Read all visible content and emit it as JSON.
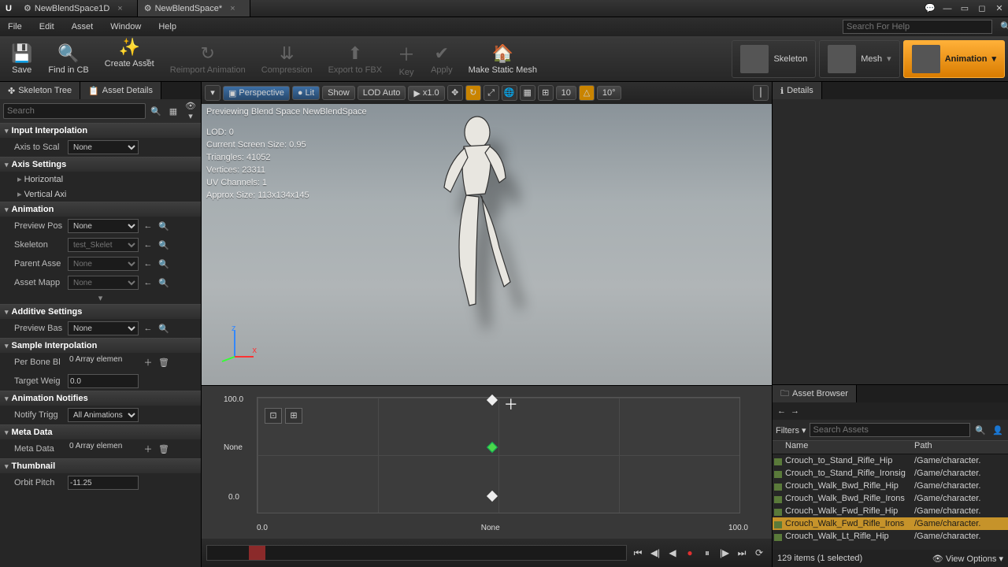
{
  "tabs": {
    "t1": "NewBlendSpace1D",
    "t2": "NewBlendSpace*"
  },
  "menu": {
    "file": "File",
    "edit": "Edit",
    "asset": "Asset",
    "window": "Window",
    "help": "Help"
  },
  "search_help_ph": "Search For Help",
  "toolbar": {
    "save": "Save",
    "find": "Find in CB",
    "create": "Create Asset",
    "reimport": "Reimport Animation",
    "compression": "Compression",
    "export": "Export to FBX",
    "key": "Key",
    "apply": "Apply",
    "static": "Make Static Mesh"
  },
  "modes": {
    "skeleton": "Skeleton",
    "mesh": "Mesh",
    "animation": "Animation"
  },
  "left_tabs": {
    "skel": "Skeleton Tree",
    "asset": "Asset Details"
  },
  "left_search_ph": "Search",
  "sections": {
    "input": "Input Interpolation",
    "axis": "Axis Settings",
    "anim": "Animation",
    "additive": "Additive Settings",
    "sample": "Sample Interpolation",
    "notifies": "Animation Notifies",
    "meta": "Meta Data",
    "thumb": "Thumbnail"
  },
  "props": {
    "axis_scale_lbl": "Axis to Scal",
    "axis_scale_val": "None",
    "horiz": "Horizontal",
    "vert": "Vertical Axi",
    "preview_pos_lbl": "Preview Pos",
    "preview_pos_val": "None",
    "skeleton_lbl": "Skeleton",
    "skeleton_val": "test_Skelet",
    "parent_lbl": "Parent Asse",
    "parent_val": "None",
    "mapping_lbl": "Asset Mapp",
    "mapping_val": "None",
    "preview_base_lbl": "Preview Bas",
    "preview_base_val": "None",
    "per_bone_lbl": "Per Bone Bl",
    "per_bone_val": "0 Array elemen",
    "target_lbl": "Target Weig",
    "target_val": "0.0",
    "notify_lbl": "Notify Trigg",
    "notify_val": "All Animations",
    "meta_lbl": "Meta Data",
    "meta_val": "0 Array elemen",
    "orbit_lbl": "Orbit Pitch",
    "orbit_val": "-11.25"
  },
  "vp_toolbar": {
    "persp": "Perspective",
    "lit": "Lit",
    "show": "Show",
    "lod": "LOD Auto",
    "speed": "x1.0",
    "grid1": "10",
    "grid2": "10°"
  },
  "vp_overlay": {
    "preview": "Previewing Blend Space NewBlendSpace",
    "lod": "LOD: 0",
    "screen": "Current Screen Size: 0.95",
    "tris": "Triangles: 41052",
    "verts": "Vertices: 23311",
    "uv": "UV Channels: 1",
    "approx": "Approx Size: 113x134x145"
  },
  "blend": {
    "y_top": "100.0",
    "y_mid": "None",
    "y_bot": "0.0",
    "x_left": "0.0",
    "x_mid": "None",
    "x_right": "100.0"
  },
  "right_tabs": {
    "details": "Details",
    "ab": "Asset Browser"
  },
  "ab": {
    "filters": "Filters",
    "search_ph": "Search Assets",
    "col_name": "Name",
    "col_path": "Path",
    "rows": [
      {
        "n": "Crouch_to_Stand_Rifle_Hip",
        "p": "/Game/character."
      },
      {
        "n": "Crouch_to_Stand_Rifle_Ironsig",
        "p": "/Game/character."
      },
      {
        "n": "Crouch_Walk_Bwd_Rifle_Hip",
        "p": "/Game/character."
      },
      {
        "n": "Crouch_Walk_Bwd_Rifle_Irons",
        "p": "/Game/character."
      },
      {
        "n": "Crouch_Walk_Fwd_Rifle_Hip",
        "p": "/Game/character."
      },
      {
        "n": "Crouch_Walk_Fwd_Rifle_Irons",
        "p": "/Game/character."
      },
      {
        "n": "Crouch_Walk_Lt_Rifle_Hip",
        "p": "/Game/character."
      }
    ],
    "selected": 5,
    "status": "129 items (1 selected)",
    "view": "View Options"
  }
}
